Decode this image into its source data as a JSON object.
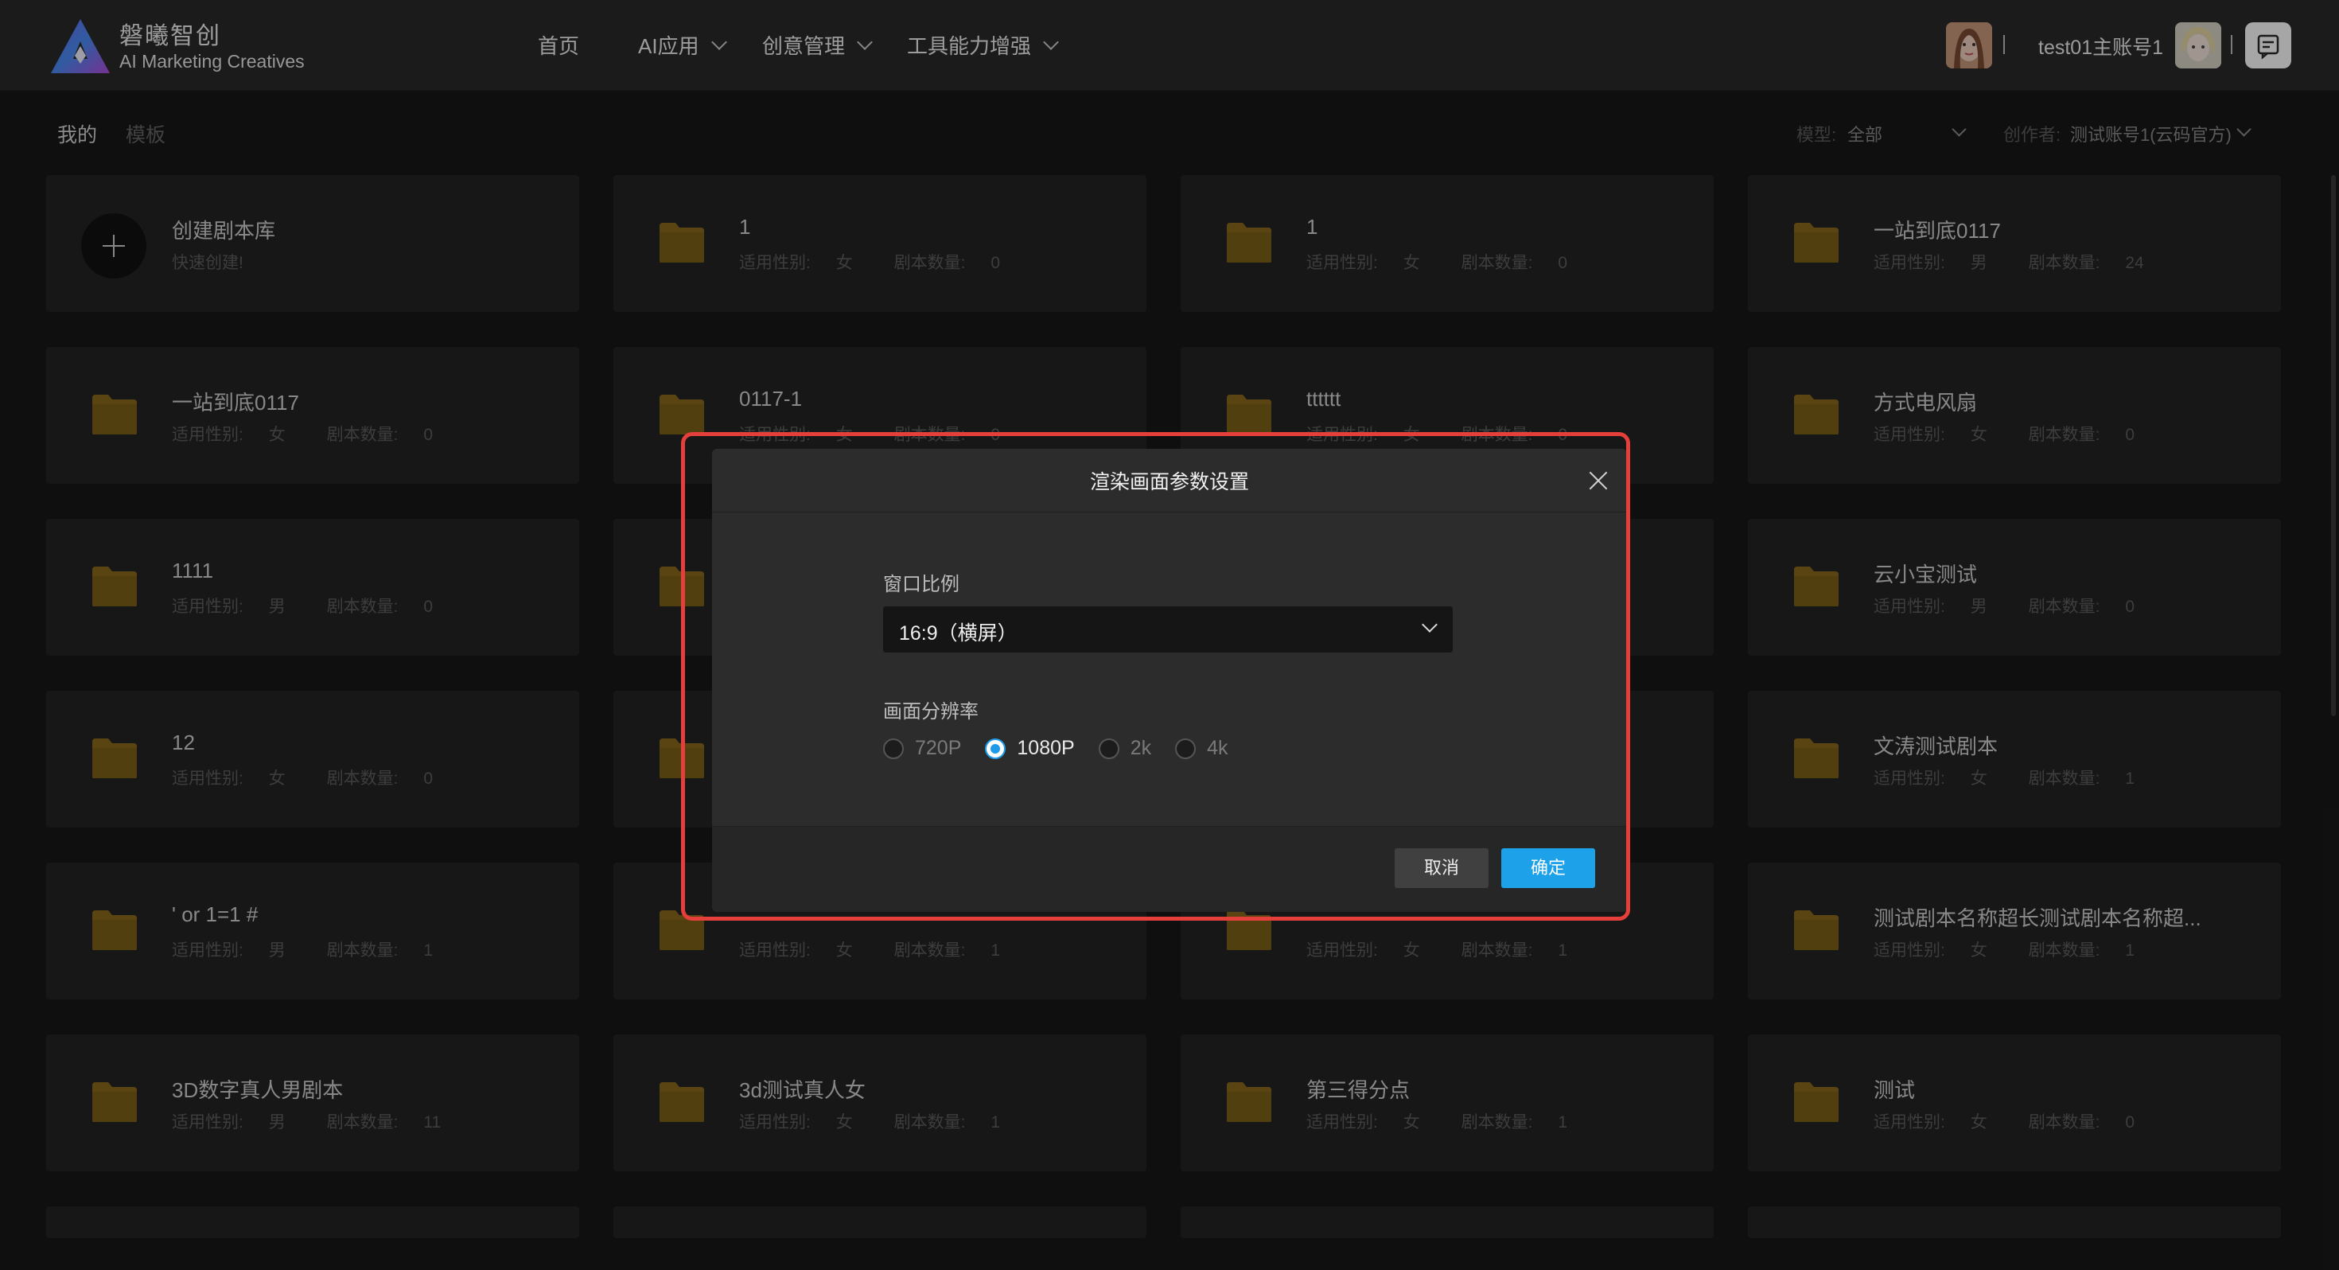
{
  "header": {
    "brand_name": "磐曦智创",
    "brand_tagline": "AI Marketing Creatives",
    "nav": [
      {
        "label": "首页",
        "has_dropdown": false
      },
      {
        "label": "AI应用",
        "has_dropdown": true
      },
      {
        "label": "创意管理",
        "has_dropdown": true
      },
      {
        "label": "工具能力增强",
        "has_dropdown": true
      }
    ],
    "username": "test01主账号1",
    "icons": {
      "message": "message-icon"
    }
  },
  "filters": {
    "tabs": [
      "我的",
      "模板"
    ],
    "active_tab": "我的",
    "model_label": "模型:",
    "model_value": "全部",
    "creator_label": "创作者:",
    "creator_value": "测试账号1(云码官方)"
  },
  "labels": {
    "gender": "适用性别:",
    "count": "剧本数量:"
  },
  "create_card": {
    "title": "创建剧本库",
    "subtitle": "快速创建!"
  },
  "libraries": [
    {
      "title": "1",
      "gender": "女",
      "count": "0"
    },
    {
      "title": "1",
      "gender": "女",
      "count": "0"
    },
    {
      "title": "一站到底0117",
      "gender": "男",
      "count": "24"
    },
    {
      "title": "一站到底0117",
      "gender": "女",
      "count": "0"
    },
    {
      "title": "0117-1",
      "gender": "女",
      "count": "0"
    },
    {
      "title": "tttttt",
      "gender": "女",
      "count": "0"
    },
    {
      "title": "方式电风扇",
      "gender": "女",
      "count": "0"
    },
    {
      "title": "1111",
      "gender": "男",
      "count": "0"
    },
    {
      "title": "",
      "gender": "",
      "count": ""
    },
    {
      "title": "",
      "gender": "",
      "count": ""
    },
    {
      "title": "云小宝测试",
      "gender": "男",
      "count": "0"
    },
    {
      "title": "12",
      "gender": "女",
      "count": "0"
    },
    {
      "title": "",
      "gender": "",
      "count": ""
    },
    {
      "title": "",
      "gender": "",
      "count": ""
    },
    {
      "title": "文涛测试剧本",
      "gender": "女",
      "count": "1"
    },
    {
      "title": "' or 1=1 #",
      "gender": "男",
      "count": "1"
    },
    {
      "title": "",
      "gender": "女",
      "count": "1"
    },
    {
      "title": "",
      "gender": "女",
      "count": "1"
    },
    {
      "title": "测试剧本名称超长测试剧本名称超...",
      "gender": "女",
      "count": "1"
    },
    {
      "title": "3D数字真人男剧本",
      "gender": "男",
      "count": "11"
    },
    {
      "title": "3d测试真人女",
      "gender": "女",
      "count": "1"
    },
    {
      "title": "第三得分点",
      "gender": "女",
      "count": "1"
    },
    {
      "title": "测试",
      "gender": "女",
      "count": "0"
    }
  ],
  "dialog": {
    "title": "渲染画面参数设置",
    "ratio_label": "窗口比例",
    "ratio_value": "16:9（横屏）",
    "resolution_label": "画面分辨率",
    "resolutions": [
      "720P",
      "1080P",
      "2k",
      "4k"
    ],
    "selected_resolution": "1080P",
    "cancel_label": "取消",
    "ok_label": "确定",
    "accent_color": "#1da1e8",
    "highlight_color": "#e43f3a"
  }
}
